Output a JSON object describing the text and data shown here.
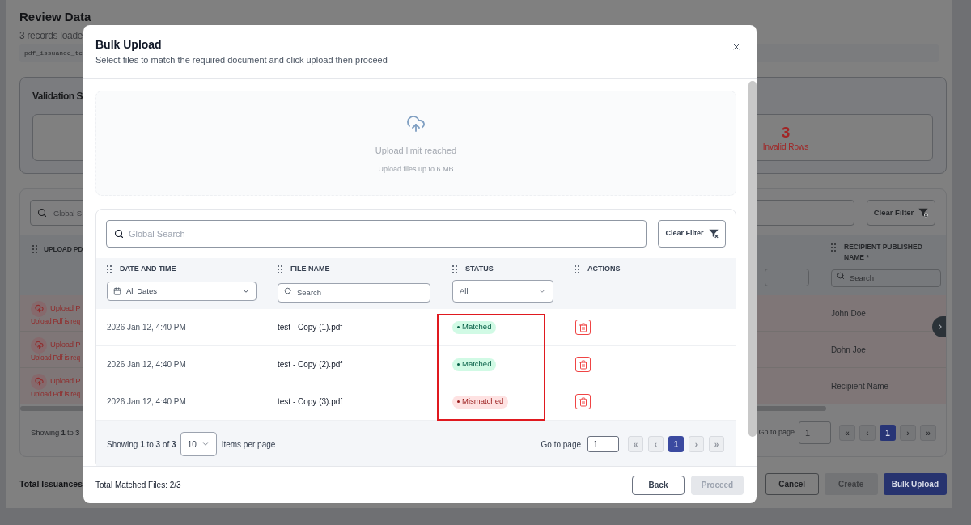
{
  "background_page": {
    "title": "Review Data",
    "subtitle": "3 records loade",
    "file_name": "pdf_issuance_te",
    "validation_summary": {
      "title": "Validation S",
      "stats": [
        {
          "value": "3",
          "label": "Invalid Rows",
          "kind": "invalid"
        }
      ]
    },
    "table": {
      "search": {
        "placeholder": "Global S"
      },
      "clear_filter_button": "Clear Filter",
      "columns": [
        {
          "kind": "upload",
          "label": "UPLOAD PD"
        },
        {
          "kind": "filter_only"
        },
        {
          "kind": "text",
          "label": "RECIPIENT PUBLISHED NAME *",
          "filter_placeholder": "Search"
        }
      ],
      "rows": [
        {
          "upload_label": "Upload P",
          "error": "Upload Pdf is req",
          "recipient_name": "John Doe"
        },
        {
          "upload_label": "Upload P",
          "error": "Upload Pdf is req",
          "recipient_name": "Dohn Joe"
        },
        {
          "upload_label": "Upload P",
          "error": "Upload Pdf is req",
          "recipient_name": "Recipient Name"
        }
      ],
      "pagination": {
        "showing": "Showing **1** to **3**",
        "go_to_page_label": "Go to page",
        "page_input": "1",
        "buttons": [
          {
            "label": "«",
            "selected": false,
            "disabled": true
          },
          {
            "label": "‹",
            "selected": false,
            "disabled": true
          },
          {
            "label": "1",
            "selected": true,
            "disabled": false
          },
          {
            "label": "›",
            "selected": false,
            "disabled": true
          },
          {
            "label": "»",
            "selected": false,
            "disabled": true
          }
        ]
      }
    },
    "actions": {
      "label": "Total Issuances",
      "buttons": [
        {
          "label": "Cancel",
          "kind": "outline",
          "disabled": false
        },
        {
          "label": "Create",
          "kind": "primary",
          "disabled": true
        },
        {
          "label": "Bulk Upload",
          "kind": "primary",
          "disabled": false
        }
      ]
    }
  },
  "dialog": {
    "title": "Bulk Upload",
    "subtitle": "Select files to match the required document and click upload then proceed",
    "dropzone": {
      "message": "Upload limit reached",
      "hint": "Upload files up to 6 MB",
      "disabled": true
    },
    "search": {
      "placeholder": "Global Search"
    },
    "clear_filter_button": "Clear Filter",
    "columns": [
      {
        "label": "DATE AND TIME",
        "filter": {
          "kind": "date_select",
          "value": "All Dates"
        }
      },
      {
        "label": "FILE NAME",
        "filter": {
          "kind": "search",
          "placeholder": "Search"
        }
      },
      {
        "label": "STATUS",
        "filter": {
          "kind": "select",
          "value": "All"
        }
      },
      {
        "label": "ACTIONS"
      }
    ],
    "rows": [
      {
        "date": "2026 Jan 12, 4:40 PM",
        "file_name": "test - Copy (1).pdf",
        "status": {
          "label": "Matched",
          "kind": "matched"
        }
      },
      {
        "date": "2026 Jan 12, 4:40 PM",
        "file_name": "test - Copy (2).pdf",
        "status": {
          "label": "Matched",
          "kind": "matched"
        }
      },
      {
        "date": "2026 Jan 12, 4:40 PM",
        "file_name": "test - Copy (3).pdf",
        "status": {
          "label": "Mismatched",
          "kind": "mismatched"
        }
      }
    ],
    "status_column_framed": true,
    "pagination": {
      "showing": "Showing **1** to **3** of **3**",
      "page_size": "10",
      "page_size_label": "Items per page",
      "go_to_page_label": "Go to page",
      "page_input": "1",
      "buttons": [
        {
          "label": "«",
          "selected": false,
          "disabled": true
        },
        {
          "label": "‹",
          "selected": false,
          "disabled": true
        },
        {
          "label": "1",
          "selected": true,
          "disabled": false
        },
        {
          "label": "›",
          "selected": false,
          "disabled": true
        },
        {
          "label": "»",
          "selected": false,
          "disabled": true
        }
      ]
    },
    "footer": {
      "summary": "Total Matched Files: 2/3",
      "buttons": [
        {
          "label": "Back",
          "kind": "outline",
          "disabled": false
        },
        {
          "label": "Proceed",
          "kind": "primary",
          "disabled": true
        }
      ]
    }
  }
}
